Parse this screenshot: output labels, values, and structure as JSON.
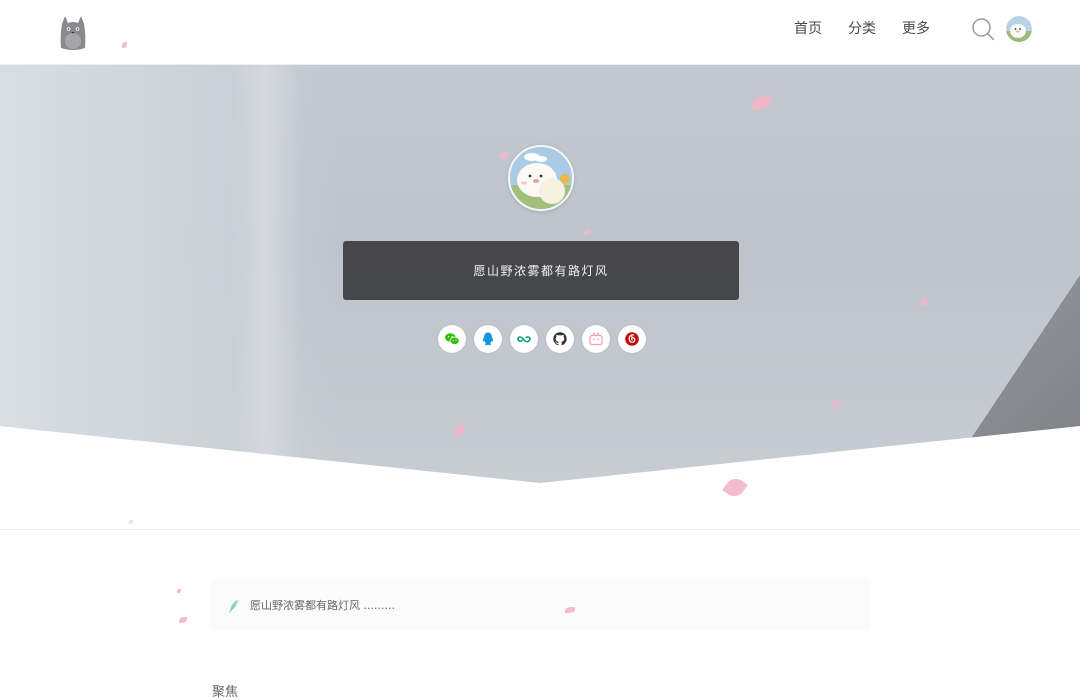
{
  "header": {
    "logo_icon": "totoro-logo-icon",
    "nav": [
      {
        "label": "首页"
      },
      {
        "label": "分类"
      },
      {
        "label": "更多"
      }
    ],
    "search_icon": "search-icon",
    "avatar_icon": "user-avatar"
  },
  "hero": {
    "avatar_icon": "profile-avatar",
    "motto": "愿山野浓雾都有路灯风",
    "social": [
      {
        "name": "wechat-icon",
        "color": "#2dc100"
      },
      {
        "name": "qq-icon",
        "color": "#1296db"
      },
      {
        "name": "infinity-icon",
        "color": "#10a37f"
      },
      {
        "name": "github-icon",
        "color": "#333333"
      },
      {
        "name": "bilibili-icon",
        "color": "#f2a0b8"
      },
      {
        "name": "netease-music-icon",
        "color": "#c20c0c"
      }
    ]
  },
  "notice": {
    "icon": "feather-icon",
    "text": "愿山野浓雾都有路灯风 ........."
  },
  "section": {
    "title": "聚焦"
  }
}
